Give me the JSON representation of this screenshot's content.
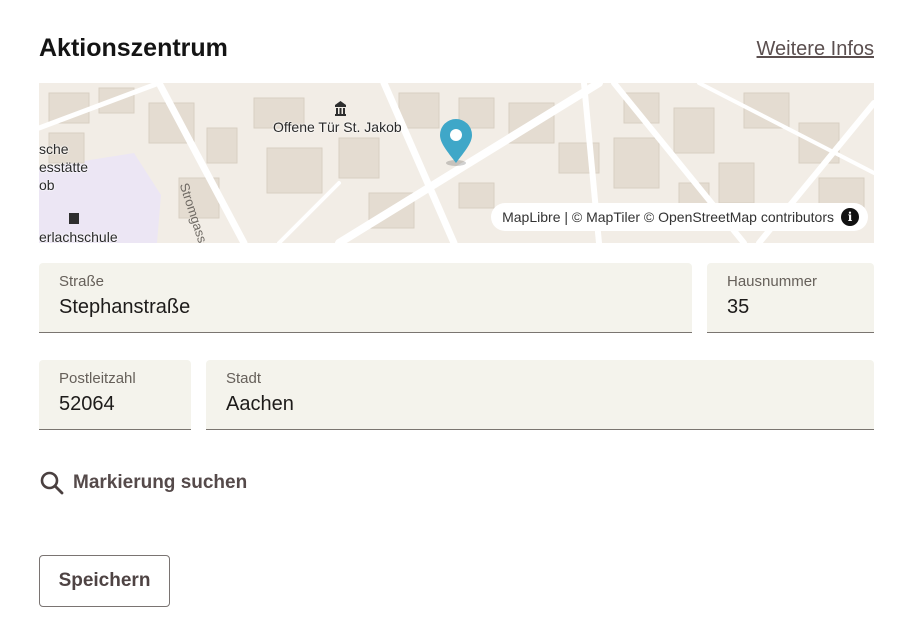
{
  "header": {
    "title": "Aktionszentrum",
    "more_link": "Weitere Infos"
  },
  "map": {
    "poi_label": "Offene Tür St. Jakob",
    "left_labels": [
      "sche",
      "esstätte",
      "ob",
      "erlachschule"
    ],
    "street_label": "Stromgasse",
    "attribution": "MapLibre | © MapTiler © OpenStreetMap contributors",
    "info_icon": "i",
    "marker_color": "#3fa7c8"
  },
  "form": {
    "street": {
      "label": "Straße",
      "value": "Stephanstraße"
    },
    "house_number": {
      "label": "Hausnummer",
      "value": "35"
    },
    "postal_code": {
      "label": "Postleitzahl",
      "value": "52064"
    },
    "city": {
      "label": "Stadt",
      "value": "Aachen"
    }
  },
  "search": {
    "label": "Markierung suchen"
  },
  "actions": {
    "save_label": "Speichern"
  }
}
